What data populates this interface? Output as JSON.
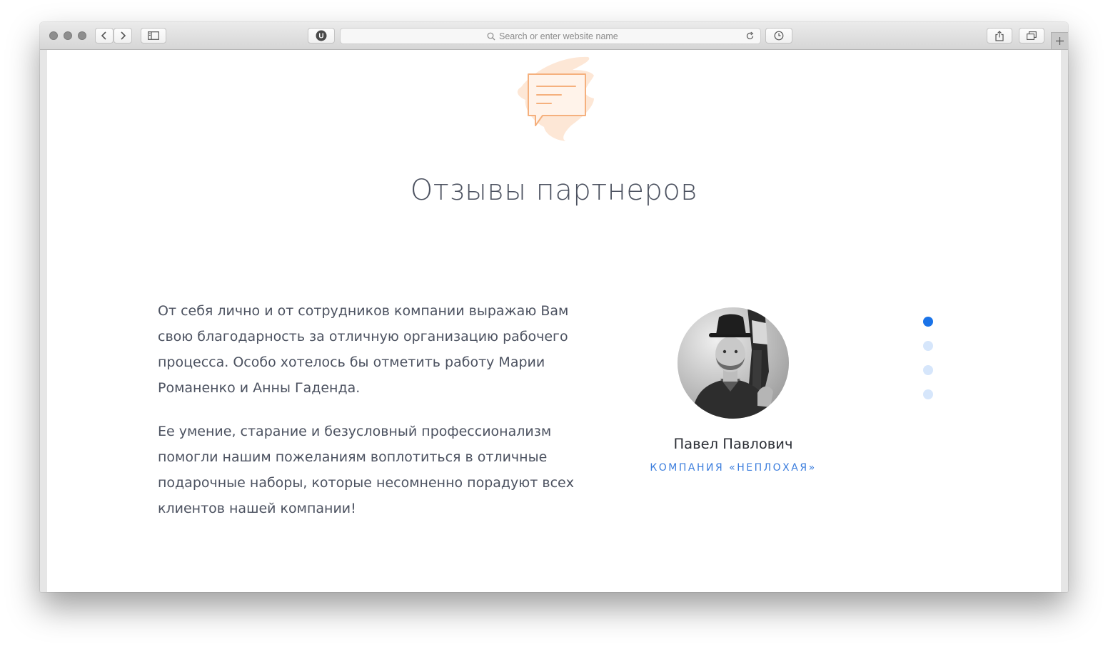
{
  "browser": {
    "url_placeholder": "Search or enter website name",
    "extension_badge": "U"
  },
  "section": {
    "icon": "chat-bubble-icon",
    "title": "Отзывы партнеров"
  },
  "review": {
    "paragraphs": [
      "От себя лично и от сотрудников компании выражаю Вам свою благодарность за отличную организацию рабочего процесса. Особо хотелось бы отметить работу Марии Романенко и Анны Гаденда.",
      "Ее умение, старание и безусловный профессионализм помогли нашим пожеланиям воплотиться в отличные подарочные наборы, которые несомненно порадуют всех клиентов нашей компании!"
    ],
    "author_name": "Павел Павлович",
    "author_company": "КОМПАНИЯ «НЕПЛОХАЯ»"
  },
  "slider": {
    "count": 4,
    "active_index": 0
  },
  "colors": {
    "accent": "#1a73e8",
    "dot_inactive": "#d6e6fb",
    "icon_orange": "#f5b07d",
    "icon_splash": "#fde3cf",
    "text": "#4c5260"
  }
}
